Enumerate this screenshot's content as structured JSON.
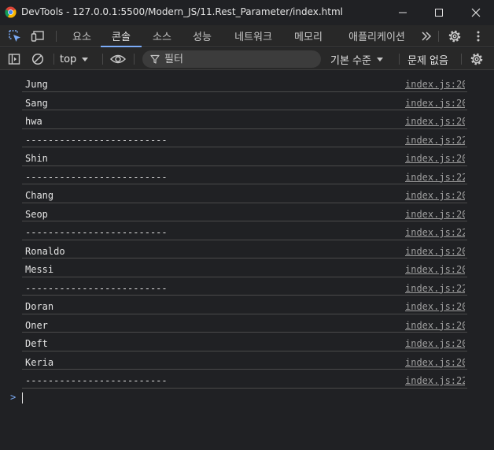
{
  "window": {
    "title": "DevTools - 127.0.0.1:5500/Modern_JS/11.Rest_Parameter/index.html"
  },
  "tabs": [
    {
      "label": "요소",
      "active": false
    },
    {
      "label": "콘솔",
      "active": true
    },
    {
      "label": "소스",
      "active": false
    },
    {
      "label": "성능",
      "active": false
    },
    {
      "label": "네트워크",
      "active": false
    },
    {
      "label": "메모리",
      "active": false
    },
    {
      "label": "애플리케이션",
      "active": false
    }
  ],
  "toolbar": {
    "context": "top",
    "filter_placeholder": "필터",
    "levels": "기본 수준",
    "issues": "문제 없음"
  },
  "logs": [
    {
      "msg": "Jung",
      "src": "index.js:20"
    },
    {
      "msg": "Sang",
      "src": "index.js:20"
    },
    {
      "msg": "hwa",
      "src": "index.js:20"
    },
    {
      "msg": "-------------------------",
      "src": "index.js:22"
    },
    {
      "msg": "Shin",
      "src": "index.js:20"
    },
    {
      "msg": "-------------------------",
      "src": "index.js:22"
    },
    {
      "msg": "Chang",
      "src": "index.js:20"
    },
    {
      "msg": "Seop",
      "src": "index.js:20"
    },
    {
      "msg": "-------------------------",
      "src": "index.js:22"
    },
    {
      "msg": "Ronaldo",
      "src": "index.js:20"
    },
    {
      "msg": "Messi",
      "src": "index.js:20"
    },
    {
      "msg": "-------------------------",
      "src": "index.js:22"
    },
    {
      "msg": "Doran",
      "src": "index.js:20"
    },
    {
      "msg": "Oner",
      "src": "index.js:20"
    },
    {
      "msg": "Deft",
      "src": "index.js:20"
    },
    {
      "msg": "Keria",
      "src": "index.js:20"
    },
    {
      "msg": "-------------------------",
      "src": "index.js:22"
    }
  ],
  "prompt": ">",
  "colors": {
    "background": "#202124",
    "accent": "#7cacf8"
  }
}
